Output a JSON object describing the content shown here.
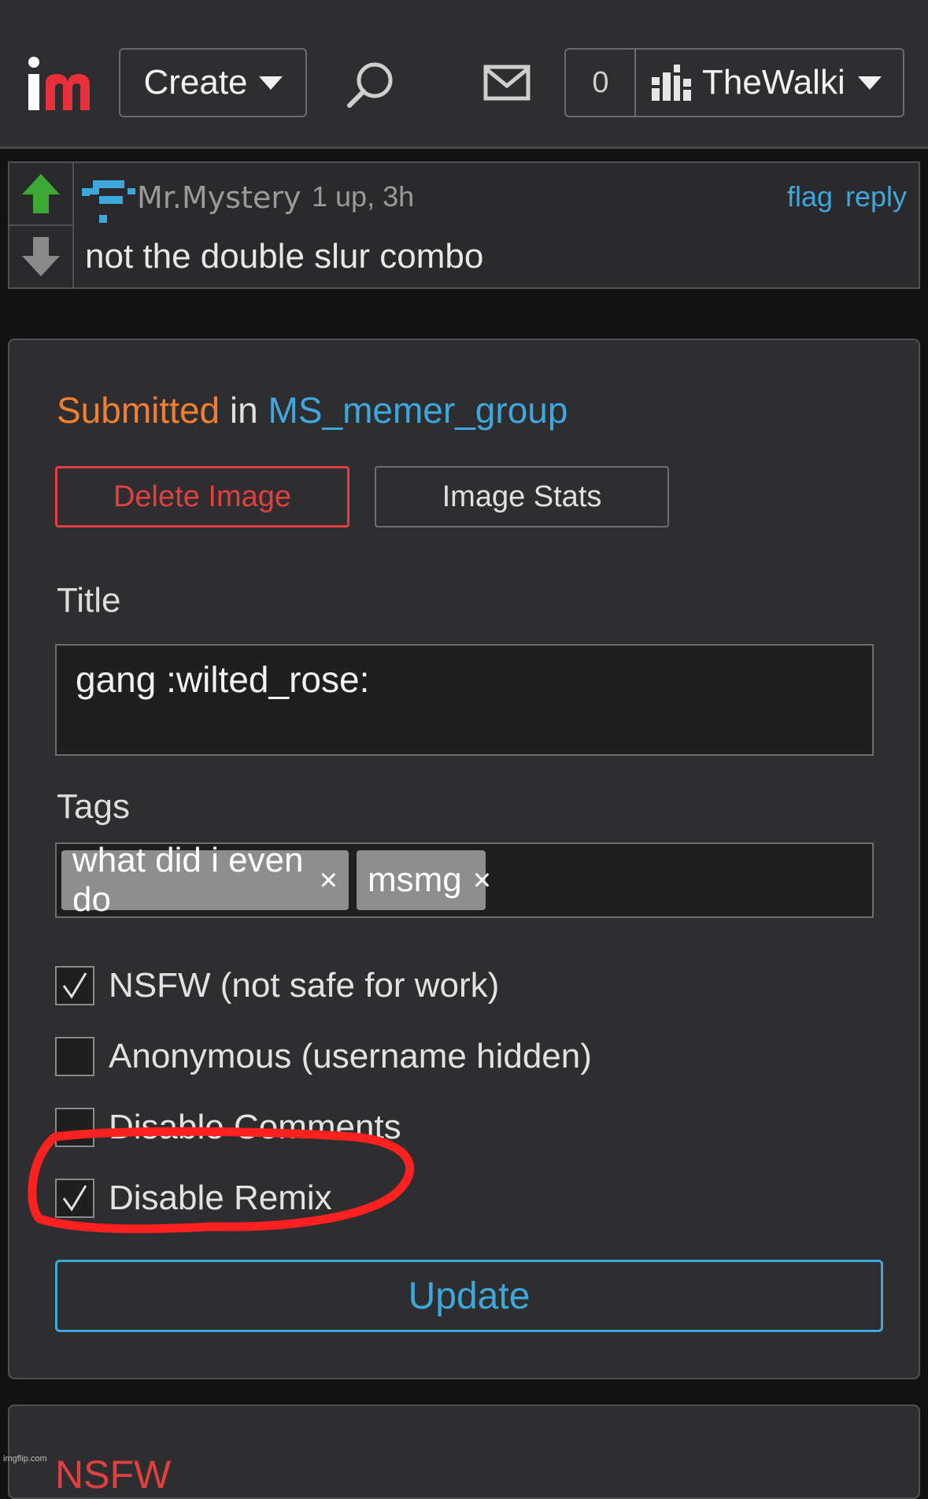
{
  "nav": {
    "create_label": "Create",
    "notification_count": "0",
    "username": "TheWalki",
    "icons": [
      "imgflip-logo",
      "search-icon",
      "mail-icon",
      "user-avatar-icon",
      "chevron-down-icon"
    ]
  },
  "comment": {
    "username": "Mr.Mystery",
    "meta": "1 up, 3h",
    "flag_label": "flag",
    "reply_label": "reply",
    "text": "not the double slur combo",
    "colors": {
      "upvote": "#3aaa35",
      "downvote": "#8a8a8a",
      "link": "#3ea7dc"
    }
  },
  "edit": {
    "submitted_label": "Submitted",
    "in_label": "in",
    "group": "MS_memer_group",
    "delete_label": "Delete Image",
    "stats_label": "Image Stats",
    "title_label": "Title",
    "title_value": "gang :wilted_rose:",
    "tags_label": "Tags",
    "tags": [
      {
        "text": "what did i even do",
        "remove": "×"
      },
      {
        "text": "msmg",
        "remove": "×"
      }
    ],
    "options": [
      {
        "label": "NSFW (not safe for work)",
        "checked": true
      },
      {
        "label": "Anonymous (username hidden)",
        "checked": false
      },
      {
        "label": "Disable Comments",
        "checked": false
      },
      {
        "label": "Disable Remix",
        "checked": true
      }
    ],
    "update_label": "Update",
    "colors": {
      "accent": "#3ea7dc",
      "danger": "#e04040",
      "submitted": "#f08030",
      "highlight": "#ff2020"
    }
  },
  "next_panel": {
    "title": "NSFW"
  },
  "watermark": "imgflip.com"
}
